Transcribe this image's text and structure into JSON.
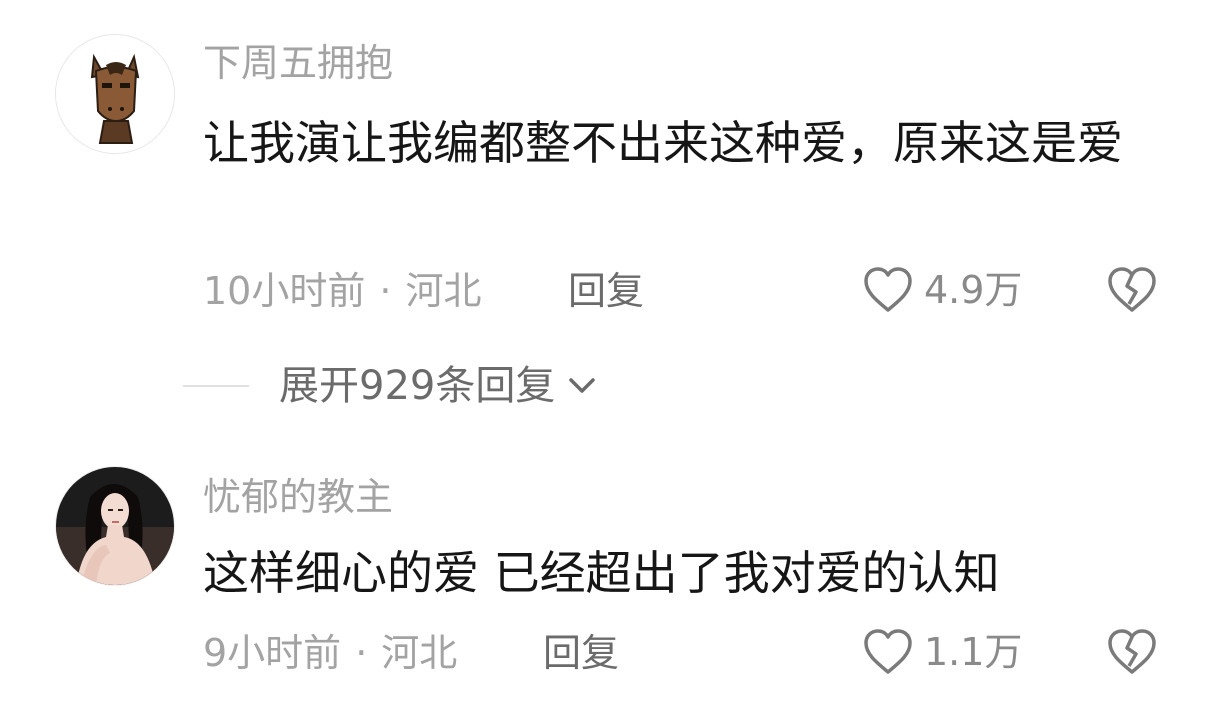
{
  "comments": [
    {
      "username": "下周五拥抱",
      "content": "让我演让我编都整不出来这种爱，原来这是爱",
      "time": "10小时前",
      "location": "河北",
      "reply_label": "回复",
      "likes": "4.9万"
    },
    {
      "username": "忧郁的教主",
      "content": "这样细心的爱 已经超出了我对爱的认知",
      "time": "9小时前",
      "location": "河北",
      "reply_label": "回复",
      "likes": "1.1万"
    }
  ],
  "expand_replies": {
    "label": "展开929条回复"
  },
  "meta_separator": "·",
  "icons": {
    "like": "heart-outline-icon",
    "dislike": "broken-heart-icon",
    "expand": "chevron-down-icon"
  },
  "colors": {
    "username": "#a3a3a3",
    "content": "#161616",
    "meta": "#a3a3a3",
    "icon": "#7a7a7a"
  }
}
